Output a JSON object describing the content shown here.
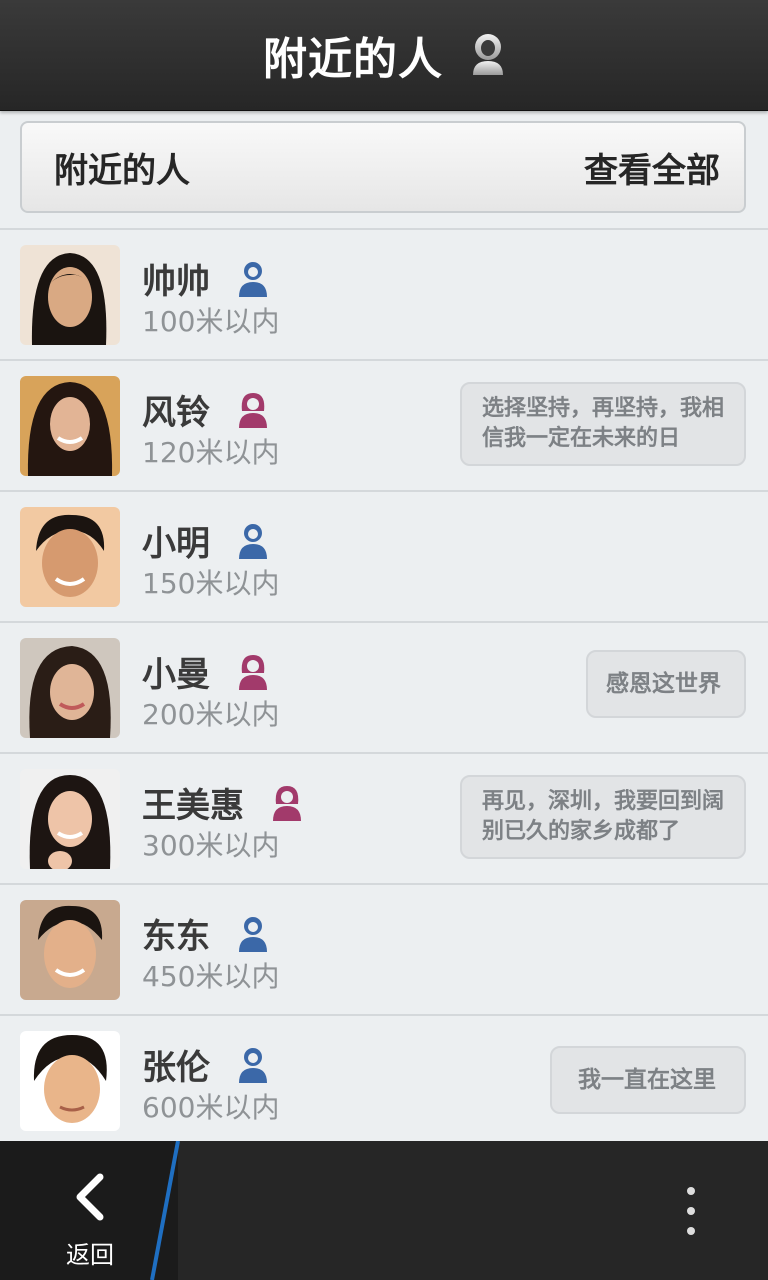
{
  "header": {
    "title": "附近的人",
    "icon": "person-icon"
  },
  "filter": {
    "left_label": "附近的人",
    "right_label": "查看全部"
  },
  "people": [
    {
      "name": "帅帅",
      "gender": "male",
      "distance": "100米以内",
      "status": ""
    },
    {
      "name": "风铃",
      "gender": "female",
      "distance": "120米以内",
      "status": "选择坚持，再坚持，我相信我一定在未来的日"
    },
    {
      "name": "小明",
      "gender": "male",
      "distance": "150米以内",
      "status": ""
    },
    {
      "name": "小曼",
      "gender": "female",
      "distance": "200米以内",
      "status": "感恩这世界"
    },
    {
      "name": "王美惠",
      "gender": "female",
      "distance": "300米以内",
      "status": "再见，深圳，我要回到阔别已久的家乡成都了"
    },
    {
      "name": "东东",
      "gender": "male",
      "distance": "450米以内",
      "status": ""
    },
    {
      "name": "张伦",
      "gender": "male",
      "distance": "600米以内",
      "status": "我一直在这里"
    }
  ],
  "bottom_bar": {
    "back_label": "返回",
    "back_icon": "chevron-left-icon",
    "more_icon": "more-vertical-icon"
  },
  "colors": {
    "male": "#3b68a8",
    "female": "#a23a6b",
    "accent": "#1f6fc2"
  }
}
